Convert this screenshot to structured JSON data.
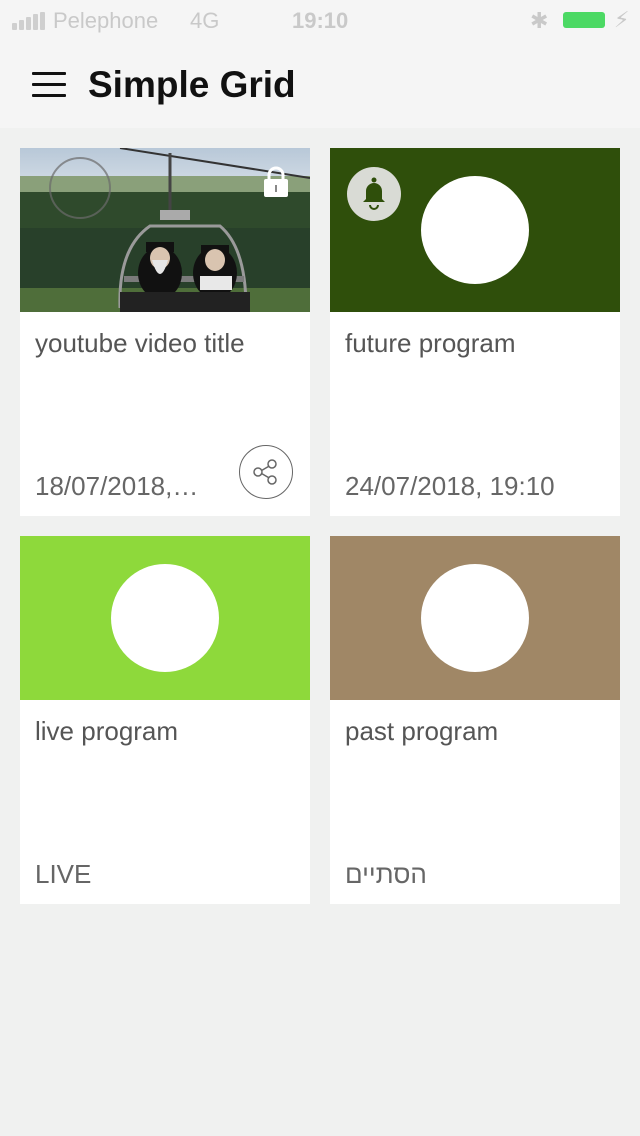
{
  "status_bar": {
    "carrier": "Pelephone",
    "network": "4G",
    "time": "19:10"
  },
  "app_bar": {
    "title": "Simple Grid"
  },
  "cards": [
    {
      "title": "youtube video title",
      "meta": "18/07/2018,…",
      "thumbnail": "photo-chairlift",
      "locked": true,
      "share": true
    },
    {
      "title": "future program",
      "meta": "24/07/2018, 19:10",
      "thumbnail_color": "#2f4f0b",
      "reminder": true
    },
    {
      "title": "live program",
      "meta": "LIVE",
      "thumbnail_color": "#8ed93b"
    },
    {
      "title": "past program",
      "meta": "הסתיים",
      "thumbnail_color": "#a08766"
    }
  ],
  "colors": {
    "background": "#f0f1f0",
    "card": "#ffffff",
    "battery": "#4cd964"
  }
}
